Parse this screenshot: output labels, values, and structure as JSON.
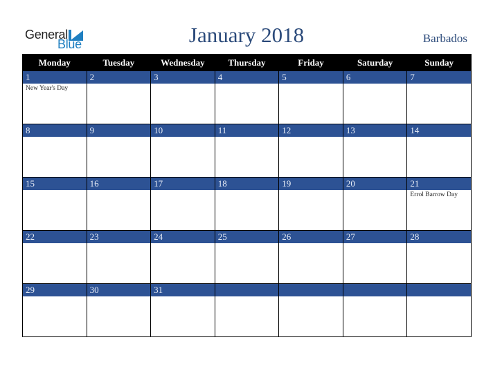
{
  "logo": {
    "line1": "General",
    "line2": "Blue"
  },
  "title": "January 2018",
  "country": "Barbados",
  "colors": {
    "band": "#2d5294",
    "header": "#000000",
    "title": "#2b4a7a",
    "logo_blue": "#1f7fc1"
  },
  "weekdays": [
    "Monday",
    "Tuesday",
    "Wednesday",
    "Thursday",
    "Friday",
    "Saturday",
    "Sunday"
  ],
  "weeks": [
    [
      {
        "day": "1",
        "holiday": "New Year's Day"
      },
      {
        "day": "2",
        "holiday": ""
      },
      {
        "day": "3",
        "holiday": ""
      },
      {
        "day": "4",
        "holiday": ""
      },
      {
        "day": "5",
        "holiday": ""
      },
      {
        "day": "6",
        "holiday": ""
      },
      {
        "day": "7",
        "holiday": ""
      }
    ],
    [
      {
        "day": "8",
        "holiday": ""
      },
      {
        "day": "9",
        "holiday": ""
      },
      {
        "day": "10",
        "holiday": ""
      },
      {
        "day": "11",
        "holiday": ""
      },
      {
        "day": "12",
        "holiday": ""
      },
      {
        "day": "13",
        "holiday": ""
      },
      {
        "day": "14",
        "holiday": ""
      }
    ],
    [
      {
        "day": "15",
        "holiday": ""
      },
      {
        "day": "16",
        "holiday": ""
      },
      {
        "day": "17",
        "holiday": ""
      },
      {
        "day": "18",
        "holiday": ""
      },
      {
        "day": "19",
        "holiday": ""
      },
      {
        "day": "20",
        "holiday": ""
      },
      {
        "day": "21",
        "holiday": "Errol Barrow Day"
      }
    ],
    [
      {
        "day": "22",
        "holiday": ""
      },
      {
        "day": "23",
        "holiday": ""
      },
      {
        "day": "24",
        "holiday": ""
      },
      {
        "day": "25",
        "holiday": ""
      },
      {
        "day": "26",
        "holiday": ""
      },
      {
        "day": "27",
        "holiday": ""
      },
      {
        "day": "28",
        "holiday": ""
      }
    ],
    [
      {
        "day": "29",
        "holiday": ""
      },
      {
        "day": "30",
        "holiday": ""
      },
      {
        "day": "31",
        "holiday": ""
      },
      {
        "day": "",
        "holiday": ""
      },
      {
        "day": "",
        "holiday": ""
      },
      {
        "day": "",
        "holiday": ""
      },
      {
        "day": "",
        "holiday": ""
      }
    ]
  ]
}
